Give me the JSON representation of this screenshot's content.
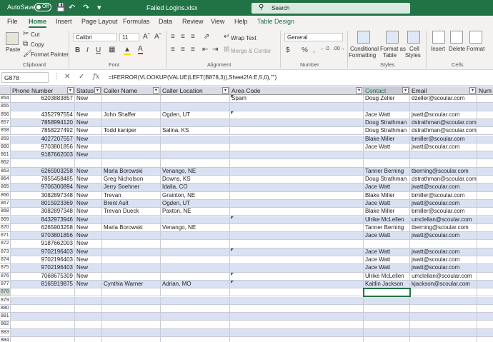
{
  "titlebar": {
    "autosave_label": "AutoSave",
    "autosave_state": "Off",
    "filename": "Failed Logins.xlsx",
    "search_placeholder": "Search",
    "bg_color": "#217346"
  },
  "tabs": [
    "File",
    "Home",
    "Insert",
    "Page Layout",
    "Formulas",
    "Data",
    "Review",
    "View",
    "Help",
    "Table Design"
  ],
  "active_tab": "Home",
  "ribbon": {
    "clipboard": {
      "paste": "Paste",
      "cut": "Cut",
      "copy": "Copy",
      "format_painter": "Format Painter",
      "group": "Clipboard"
    },
    "font": {
      "name": "Calibri",
      "size": "11",
      "group": "Font"
    },
    "alignment": {
      "wrap_text": "Wrap Text",
      "merge_center": "Merge & Center",
      "group": "Alignment"
    },
    "number": {
      "format": "General",
      "group": "Number"
    },
    "styles": {
      "conditional": [
        "Conditional",
        "Formatting"
      ],
      "format_table": [
        "Format as",
        "Table"
      ],
      "cell_styles": [
        "Cell",
        "Styles"
      ],
      "group": "Styles"
    },
    "cells": {
      "insert": "Insert",
      "delete": "Delete",
      "format": "Format",
      "group": "Cells"
    }
  },
  "formula_bar": {
    "name_box": "G878",
    "formula": "=IFERROR(VLOOKUP(VALUE(LEFT(B878,3)),Sheet2!A:E,5,0),\"\")"
  },
  "columns": [
    "Phone Number",
    "Status",
    "Caller Name",
    "Caller Location",
    "Area Code",
    "Contact",
    "Email",
    "Num"
  ],
  "rows": [
    {
      "n": "854",
      "cells": [
        "6203883857",
        "New",
        "",
        "",
        "Spam",
        "Doug Zeller",
        "dzeller@scoular.com"
      ]
    },
    {
      "n": "855",
      "cells": [
        "",
        "",
        "",
        "",
        "",
        "",
        ""
      ]
    },
    {
      "n": "856",
      "cells": [
        "4352797554",
        "New",
        "John Shaffer",
        "Ogden, UT",
        "",
        "Jace Watt",
        "jwatt@scoular.com"
      ]
    },
    {
      "n": "857",
      "cells": [
        "7858994120",
        "New",
        "",
        "",
        "",
        "Doug Strathman",
        "dstrathman@scoular.com"
      ]
    },
    {
      "n": "858",
      "cells": [
        "7858227492",
        "New",
        "Todd kaniper",
        "Salina, KS",
        "",
        "Doug Strathman",
        "dstrathman@scoular.com"
      ]
    },
    {
      "n": "859",
      "cells": [
        "4027207557",
        "New",
        "",
        "",
        "",
        "Blake Miller",
        "bmiller@scoular.com"
      ]
    },
    {
      "n": "860",
      "cells": [
        "9703801856",
        "New",
        "",
        "",
        "",
        "Jace Watt",
        "jwatt@scoular.com"
      ]
    },
    {
      "n": "861",
      "cells": [
        "9187662003",
        "New",
        "",
        "",
        "",
        "",
        ""
      ]
    },
    {
      "n": "862",
      "cells": [
        "",
        "",
        "",
        "",
        "",
        "",
        ""
      ]
    },
    {
      "n": "863",
      "cells": [
        "6265903258",
        "New",
        "Marla Borowski",
        "Venango, NE",
        "",
        "Tanner Berning",
        "tberning@scoular.com"
      ]
    },
    {
      "n": "864",
      "cells": [
        "7855458485",
        "New",
        "Greg Nicholson",
        "Downs, KS",
        "",
        "Doug Strathman",
        "dstrathman@scoular.com"
      ]
    },
    {
      "n": "865",
      "cells": [
        "9706300894",
        "New",
        "Jerry Soehner",
        "Idalia, CO",
        "",
        "Jace Watt",
        "jwatt@scoular.com"
      ]
    },
    {
      "n": "866",
      "cells": [
        "3082897348",
        "New",
        "Trevan",
        "Grainton, NE",
        "",
        "Blake Miller",
        "bmiller@scoular.com"
      ]
    },
    {
      "n": "867",
      "cells": [
        "8015923369",
        "New",
        "Brent Ault",
        "Ogden, UT",
        "",
        "Jace Watt",
        "jwatt@scoular.com"
      ]
    },
    {
      "n": "868",
      "cells": [
        "3082897348",
        "New",
        "Trevan Dueck",
        "Paxton, NE",
        "",
        "Blake Miller",
        "bmiller@scoular.com"
      ]
    },
    {
      "n": "869",
      "cells": [
        "8432973946",
        "New",
        "",
        "",
        "",
        "Ulrike McLellen",
        "umclellan@scoular.com"
      ]
    },
    {
      "n": "870",
      "cells": [
        "6265903258",
        "New",
        "Marla Borowski",
        "Venango, NE",
        "",
        "Tanner Berning",
        "tberning@scoular.com"
      ]
    },
    {
      "n": "871",
      "cells": [
        "9703801856",
        "New",
        "",
        "",
        "",
        "Jace Watt",
        "jwatt@scoular.com"
      ]
    },
    {
      "n": "872",
      "cells": [
        "9187662003",
        "New",
        "",
        "",
        "",
        "",
        ""
      ]
    },
    {
      "n": "873",
      "cells": [
        "9702196403",
        "New",
        "",
        "",
        "",
        "Jace Watt",
        "jwatt@scoular.com"
      ]
    },
    {
      "n": "874",
      "cells": [
        "9702196403",
        "New",
        "",
        "",
        "",
        "Jace Watt",
        "jwatt@scoular.com"
      ]
    },
    {
      "n": "875",
      "cells": [
        "9702196403",
        "New",
        "",
        "",
        "",
        "Jace Watt",
        "jwatt@scoular.com"
      ]
    },
    {
      "n": "876",
      "cells": [
        "7068675309",
        "New",
        "",
        "",
        "",
        "Ulrike McLellen",
        "umclellan@scoular.com"
      ]
    },
    {
      "n": "877",
      "cells": [
        "8165919875",
        "New",
        "Cynthia Warner",
        "Adrian, MO",
        "",
        "Kaitlin Jackson",
        "kjackson@scoular.com"
      ]
    },
    {
      "n": "878",
      "cells": [
        "",
        "",
        "",
        "",
        "",
        "",
        ""
      ]
    },
    {
      "n": "879",
      "cells": [
        "",
        "",
        "",
        "",
        "",
        "",
        ""
      ]
    },
    {
      "n": "880",
      "cells": [
        "",
        "",
        "",
        "",
        "",
        "",
        ""
      ]
    },
    {
      "n": "881",
      "cells": [
        "",
        "",
        "",
        "",
        "",
        "",
        ""
      ]
    },
    {
      "n": "882",
      "cells": [
        "",
        "",
        "",
        "",
        "",
        "",
        ""
      ]
    },
    {
      "n": "883",
      "cells": [
        "",
        "",
        "",
        "",
        "",
        "",
        ""
      ]
    },
    {
      "n": "884",
      "cells": [
        "",
        "",
        "",
        "",
        "",
        "",
        ""
      ]
    }
  ]
}
